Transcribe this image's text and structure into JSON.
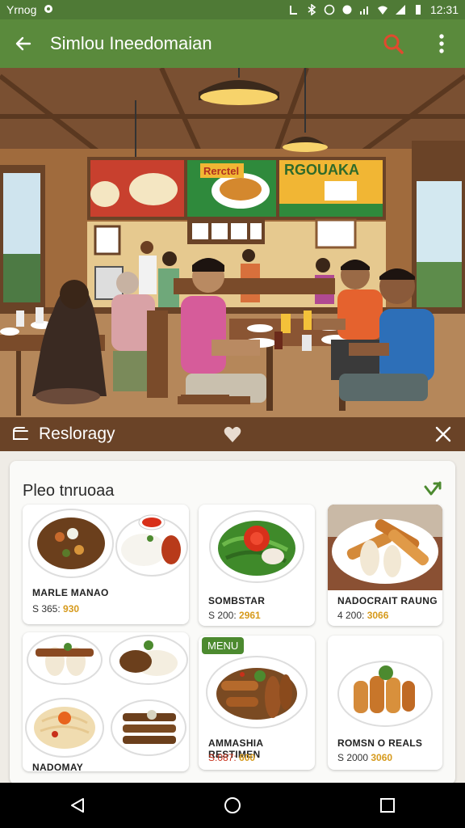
{
  "status_bar": {
    "carrier": "Yrnog",
    "time": "12:31"
  },
  "app_bar": {
    "title": "Simlou Ineedomaian"
  },
  "sheet_header": {
    "label": "Resloragy"
  },
  "panel": {
    "title": "Pleo tnruoaa"
  },
  "hero": {
    "sign_text": "RGOUAKA",
    "sign_tag": "Rerctel"
  },
  "cards": [
    {
      "name": "MARLE MANAO",
      "price_prefix": "S 365: ",
      "price_highlight": "930"
    },
    {
      "name": "SOMBSTAR",
      "price_prefix": "S 200: ",
      "price_highlight": "2961"
    },
    {
      "name": "NADOCRAIT RAUNG",
      "price_prefix": "4 200: ",
      "price_highlight": "3066"
    },
    {
      "name": "NADOMAY",
      "price_prefix": "",
      "price_highlight": ""
    },
    {
      "name": "AMMASHIA RESTIMEN",
      "price_prefix": "S:087: ",
      "price_highlight": "600",
      "badge": "MENU"
    },
    {
      "name": "ROMSN O REALS",
      "price_prefix": "S 2000 ",
      "price_highlight": "3060"
    }
  ],
  "colors": {
    "app_bar": "#5a8a3c",
    "status_bar": "#4f7a36",
    "sheet_header": "#6a4327",
    "search_icon": "#e04a2e",
    "price_accent": "#d69a1c",
    "badge": "#4c8a2f"
  },
  "icons": [
    "back-arrow-icon",
    "search-icon",
    "more-vert-icon",
    "bookmark-icon",
    "heart-icon",
    "close-icon",
    "check-icon",
    "nav-back-icon",
    "nav-home-icon",
    "nav-recents-icon"
  ]
}
